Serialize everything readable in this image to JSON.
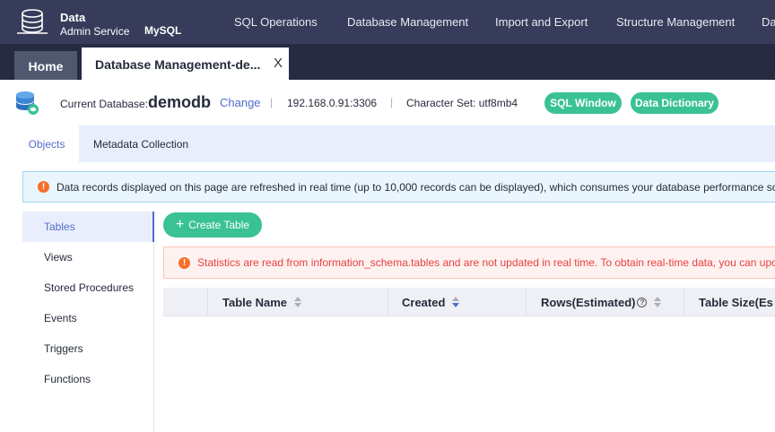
{
  "header": {
    "brand_line1": "Data",
    "brand_line2": "Admin Service",
    "engine": "MySQL",
    "nav": [
      "SQL Operations",
      "Database Management",
      "Import and Export",
      "Structure Management",
      "Da"
    ]
  },
  "tabs": {
    "home": "Home",
    "active": "Database Management-de...",
    "close_icon": "X"
  },
  "dbbar": {
    "current_label": "Current Database:",
    "current_value": "demodb",
    "change": "Change",
    "separator": "|",
    "ip": "192.168.0.91:3306",
    "charset": "Character Set: utf8mb4",
    "sql_window": "SQL Window",
    "data_dictionary": "Data Dictionary"
  },
  "subtabs": [
    "Objects",
    "Metadata Collection"
  ],
  "notice": "Data records displayed on this page are refreshed in real time (up to 10,000 records can be displayed), which consumes your database performance so",
  "sidebar": [
    "Tables",
    "Views",
    "Stored Procedures",
    "Events",
    "Triggers",
    "Functions"
  ],
  "create_button": "Create Table",
  "stats_notice": "Statistics are read from information_schema.tables and are not updated in real time. To obtain real-time data, you can upo",
  "table": {
    "columns": [
      "Table Name",
      "Created",
      "Rows(Estimated)",
      "Table Size(Es"
    ]
  },
  "colors": {
    "topbar": "#363c59",
    "tabbar": "#262b42",
    "accent_green": "#3ac295",
    "link_blue": "#526ecc",
    "warning_orange": "#f66f2a",
    "error_red": "#e63f3f"
  }
}
